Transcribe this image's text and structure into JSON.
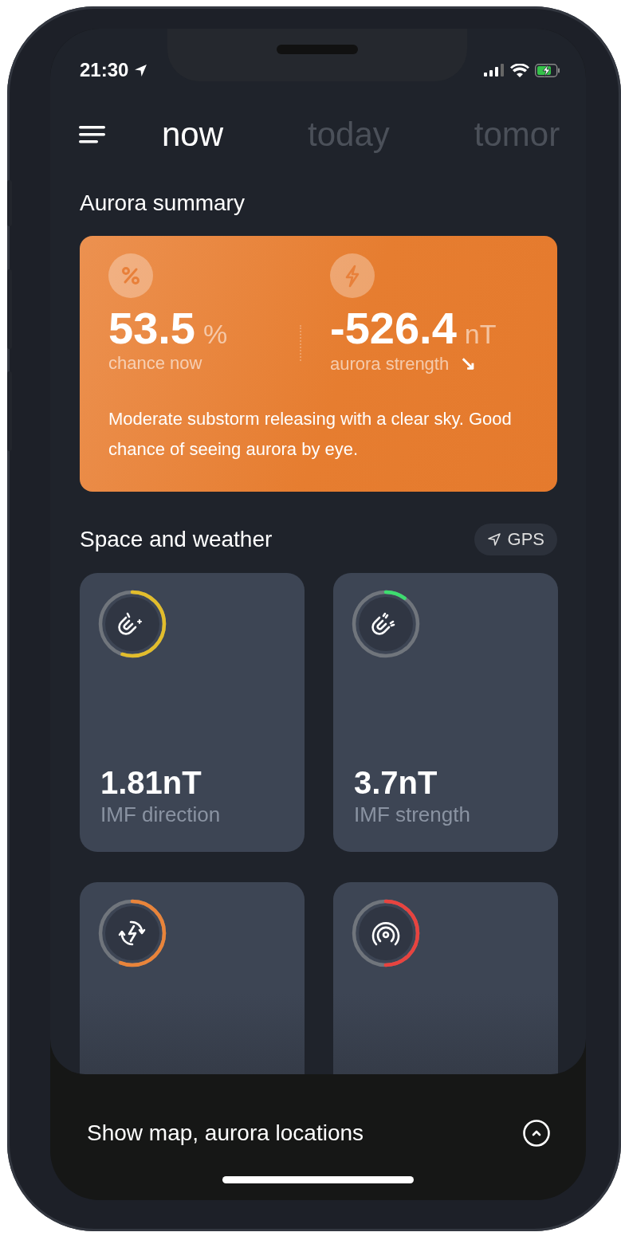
{
  "status_bar": {
    "time": "21:30"
  },
  "tabs": [
    {
      "label": "now",
      "selected": true
    },
    {
      "label": "today",
      "selected": false
    },
    {
      "label": "tomor",
      "selected": false
    }
  ],
  "summary": {
    "title": "Aurora summary",
    "chance": {
      "value": "53.5",
      "unit": "%",
      "label": "chance now"
    },
    "strength": {
      "value": "-526.4",
      "unit": "nT",
      "label": "aurora strength",
      "trend": "↘"
    },
    "description": "Moderate substorm releasing with a clear sky. Good chance of seeing aurora by eye."
  },
  "space_weather": {
    "title": "Space and weather",
    "gps_button": "GPS",
    "cards": [
      {
        "kind": "imf-direction",
        "value": "1.81nT",
        "label": "IMF direction",
        "level": 0.55,
        "color": "#e2bd2c"
      },
      {
        "kind": "imf-strength",
        "value": "3.7nT",
        "label": "IMF strength",
        "level": 0.1,
        "color": "#3ddc6f"
      },
      {
        "kind": "substorm",
        "level": 0.56,
        "color": "#e9843a"
      },
      {
        "kind": "signal",
        "level": 0.5,
        "color": "#e8433f"
      }
    ]
  },
  "bottom_sheet": {
    "label": "Show map, aurora locations"
  }
}
